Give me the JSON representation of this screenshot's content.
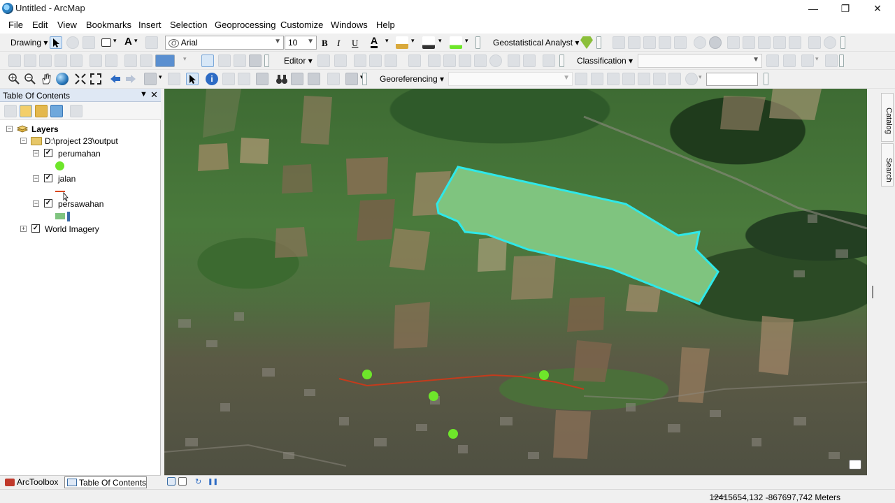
{
  "window": {
    "title": "Untitled - ArcMap"
  },
  "menus": [
    "File",
    "Edit",
    "View",
    "Bookmarks",
    "Insert",
    "Selection",
    "Geoprocessing",
    "Customize",
    "Windows",
    "Help"
  ],
  "toolbars": {
    "drawing_label": "Drawing",
    "font_name": "Arial",
    "font_size": "10",
    "bold": "B",
    "italic": "I",
    "underline": "U",
    "font_color_letter": "A",
    "geostatistical_label": "Geostatistical Analyst",
    "editor_label": "Editor",
    "classification_label": "Classification",
    "georeferencing_label": "Georeferencing"
  },
  "toc": {
    "title": "Table Of Contents",
    "root": "Layers",
    "folder": "D:\\project 23\\output",
    "layers": [
      {
        "name": "perumahan",
        "checked": true,
        "symbol": "point",
        "color": "#6ee62a"
      },
      {
        "name": "jalan",
        "checked": true,
        "symbol": "line",
        "color": "#d9481e"
      },
      {
        "name": "persawahan",
        "checked": true,
        "symbol": "polygon",
        "color": "#7fc47f"
      }
    ],
    "basemap": {
      "name": "World Imagery",
      "checked": true
    }
  },
  "bottom_tabs": {
    "arctoolbox": "ArcToolbox",
    "toc": "Table Of Contents"
  },
  "side_tabs": {
    "catalog": "Catalog",
    "search": "Search"
  },
  "status": {
    "coordinates": "12415654,132  -867697,742 Meters"
  },
  "map": {
    "polygon_fill": "#7fc47f",
    "polygon_outline": "#2fe8e8",
    "point_color": "#6ee62a",
    "line_color": "#c43b1c"
  }
}
